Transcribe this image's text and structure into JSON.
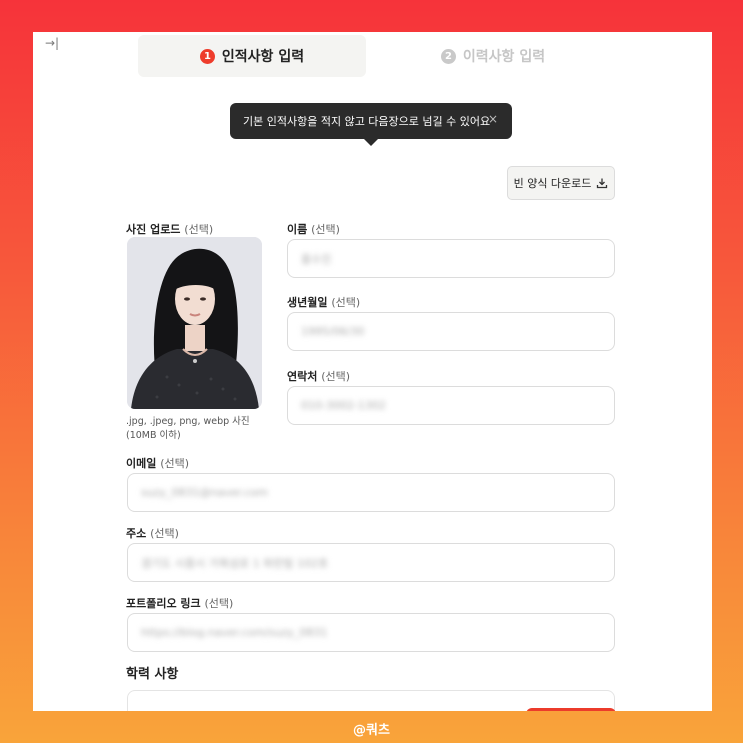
{
  "steps": [
    {
      "number": "1",
      "label": "인적사항 입력"
    },
    {
      "number": "2",
      "label": "이력사항 입력"
    }
  ],
  "collapse_icon": "→|",
  "tooltip": {
    "text": "기본 인적사항을 적지 않고 다음장으로 넘길 수 있어요",
    "close": "×"
  },
  "download_button": {
    "label": "빈 양식 다운로드",
    "icon": "download-icon"
  },
  "photo": {
    "label": "사진 업로드",
    "optional": "(선택)",
    "hint": ".jpg, .jpeg, png, webp 사진 (10MB 이하)"
  },
  "fields": {
    "name": {
      "label": "이름",
      "optional": "(선택)",
      "value": "홍수진"
    },
    "birth": {
      "label": "생년월일",
      "optional": "(선택)",
      "value": "1995/06/30"
    },
    "phone": {
      "label": "연락처",
      "optional": "(선택)",
      "value": "010-3002-1302"
    },
    "email": {
      "label": "이메일",
      "optional": "(선택)",
      "value": "suzy_0831@naver.com"
    },
    "address": {
      "label": "주소",
      "optional": "(선택)",
      "value": "경기도 시흥시 거북섬로 1 파란빌 102호"
    },
    "portfolio": {
      "label": "포트폴리오 링크",
      "optional": "(선택)",
      "value": "https://blog.naver.com/suzy_0831"
    }
  },
  "education": {
    "title": "학력 사항"
  },
  "watermark": "@쿼츠",
  "colors": {
    "accent": "#ee3c2c",
    "frame_top": "#f6333a",
    "frame_bottom": "#f9a43a"
  }
}
